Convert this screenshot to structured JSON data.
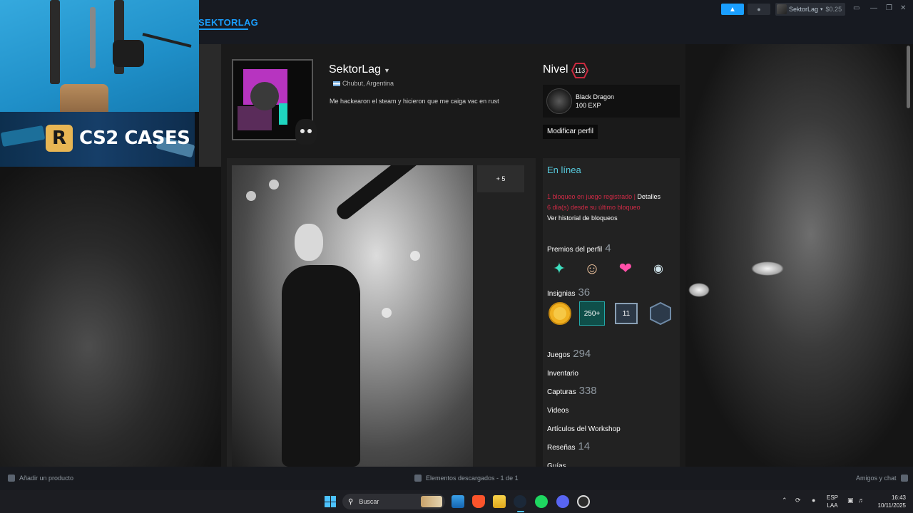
{
  "steam": {
    "nav_active": "SEKTORLAG",
    "account_name": "SektorLag",
    "account_balance": "$0.25"
  },
  "overlay": {
    "banner_logo": "R",
    "banner_title": "CS2 CASES"
  },
  "profile": {
    "name": "SektorLag",
    "location": "Chubut, Argentina",
    "summary": "Me hackearon el steam y hicieron que me caiga vac en rust",
    "level_label": "Nivel",
    "level_value": "113",
    "featured_badge": {
      "name": "Black Dragon",
      "exp": "100 EXP"
    },
    "edit_button": "Modificar perfil",
    "showcase_more": "+ 5",
    "status": "En línea",
    "ban_line1": "1 bloqueo en juego registrado",
    "ban_sep": " | ",
    "ban_details": "Detalles",
    "ban_line2": "6 día(s) desde su último bloqueo",
    "ban_history": "Ver historial de bloqueos",
    "sections": {
      "awards_label": "Premios del perfil",
      "awards_count": "4",
      "badges_label": "Insignias",
      "badges_count": "36",
      "badge_items": [
        "250+",
        "11"
      ],
      "games_label": "Juegos",
      "games_count": "294",
      "inventory_label": "Inventario",
      "screenshots_label": "Capturas",
      "screenshots_count": "338",
      "videos_label": "Videos",
      "workshop_label": "Artículos del Workshop",
      "reviews_label": "Reseñas",
      "reviews_count": "14",
      "guides_label": "Guías"
    }
  },
  "statusbar": {
    "add_product": "Añadir un producto",
    "downloads": "Elementos descargados - 1 de 1",
    "friends_chat": "Amigos y chat"
  },
  "taskbar": {
    "search_placeholder": "Buscar",
    "lang_top": "ESP",
    "lang_bottom": "LAA",
    "time": "16:43",
    "date": "10/11/2025"
  },
  "colors": {
    "accent": "#1a9fff",
    "online": "#57cbde",
    "ban": "#cf2a46"
  }
}
